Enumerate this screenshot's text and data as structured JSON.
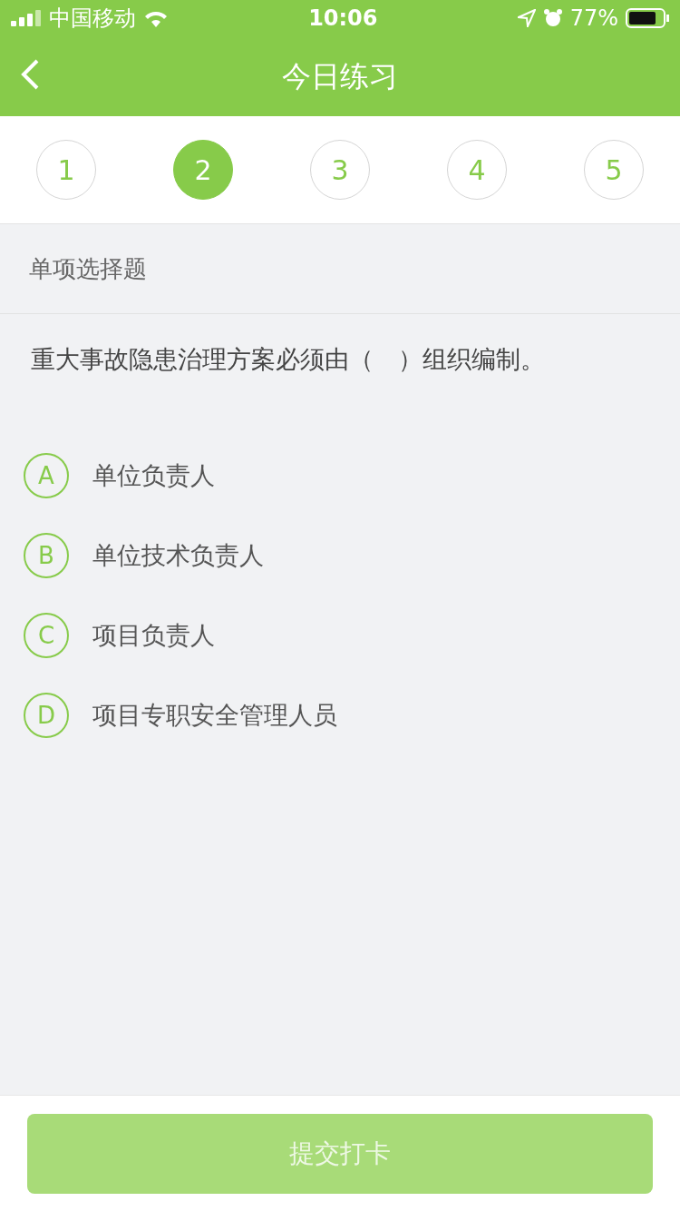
{
  "status_bar": {
    "carrier": "中国移动",
    "time": "10:06",
    "battery": "77%"
  },
  "nav": {
    "title": "今日练习"
  },
  "steps": [
    {
      "label": "1",
      "selected": false
    },
    {
      "label": "2",
      "selected": true
    },
    {
      "label": "3",
      "selected": false
    },
    {
      "label": "4",
      "selected": false
    },
    {
      "label": "5",
      "selected": false
    }
  ],
  "section": "单项选择题",
  "question": "重大事故隐患治理方案必须由（　）组织编制。",
  "options": [
    {
      "letter": "A",
      "text": "单位负责人",
      "selected": false
    },
    {
      "letter": "B",
      "text": "单位技术负责人",
      "selected": false
    },
    {
      "letter": "C",
      "text": "项目负责人",
      "selected": false
    },
    {
      "letter": "D",
      "text": "项目专职安全管理人员",
      "selected": false
    }
  ],
  "submit": {
    "label": "提交打卡",
    "disabled": true
  }
}
